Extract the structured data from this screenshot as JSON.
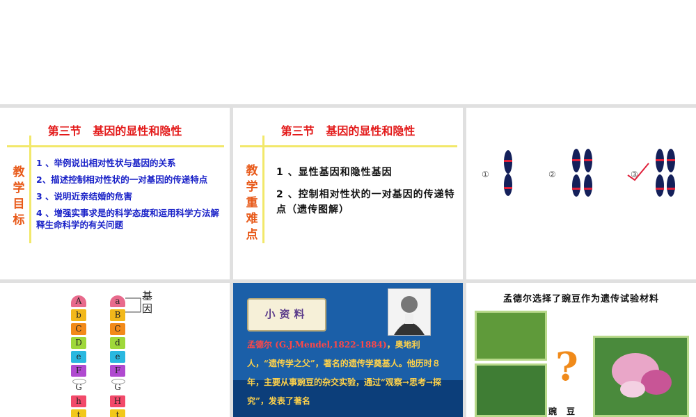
{
  "slide1": {
    "title": "第三节   基因的显性和隐性",
    "side_label": [
      "教",
      "学",
      "目",
      "标"
    ],
    "goals": [
      "1 、举例说出相对性状与基因的关系",
      "2、描述控制相对性状的一对基因的传递特点",
      "3 、说明近亲结婚的危害",
      "4 、增强实事求是的科学态度和运用科学方法解释生命科学的有关问题"
    ]
  },
  "slide2": {
    "title": "第三节   基因的显性和隐性",
    "side_label": [
      "教",
      "学",
      "重",
      "难",
      "点"
    ],
    "points": [
      "1 、显性基因和隐性基因",
      "2 、控制相对性状的一对基因的传递特点（遗传图解）"
    ]
  },
  "slide3": {
    "labels": [
      "①",
      "②",
      "③"
    ],
    "chromosome_color": "#14205a",
    "band_color": "#e0203a"
  },
  "slide4": {
    "gene_label": "基因",
    "left_strand": [
      "A",
      "b",
      "C",
      "D",
      "e",
      "F",
      "G",
      "h",
      "t"
    ],
    "right_strand": [
      "a",
      "B",
      "C",
      "d",
      "e",
      "F",
      "G",
      "H",
      "t"
    ]
  },
  "slide5": {
    "tag": "小资料",
    "bio_name": "孟德尔 (G.J.Mendel,1822-1884)",
    "bio_text": "，奥地利人，“遗传学之父”，著名的遗传学奠基人。他历时８年，主要从事豌豆的杂交实验，通过“观察→思考→探究”，发表了著名"
  },
  "slide6": {
    "title": "孟德尔选择了豌豆作为遗传试验材料",
    "question_mark": "?",
    "caption": "豌豆"
  }
}
